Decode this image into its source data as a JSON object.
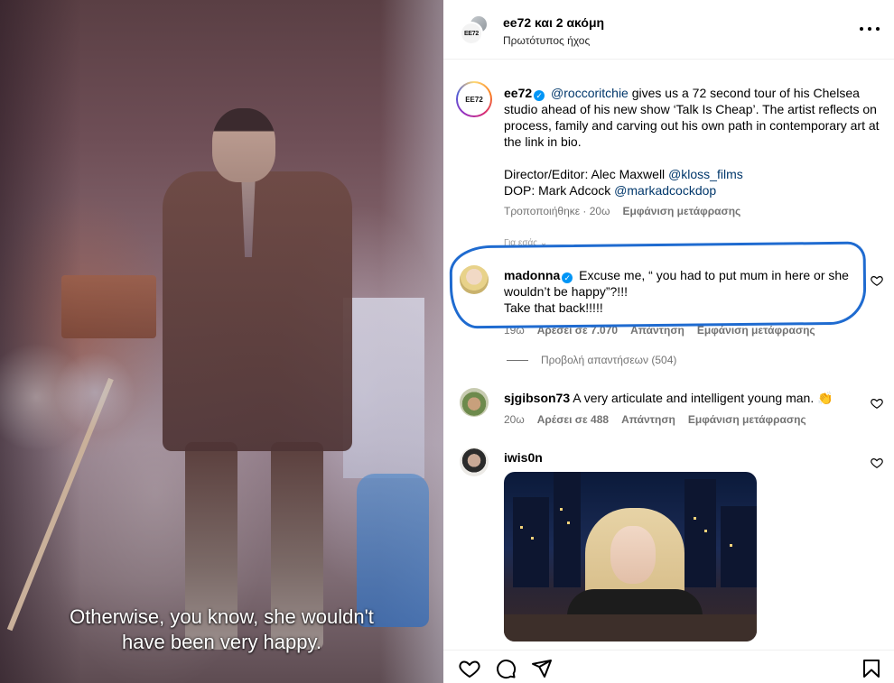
{
  "video": {
    "subtitle_line1": "Otherwise, you know, she wouldn't",
    "subtitle_line2": "have been very happy."
  },
  "header": {
    "username": "ee72",
    "and_more": "και 2 ακόμη",
    "audio": "Πρωτότυπος ήχος",
    "avatar_text": "EE72"
  },
  "caption": {
    "username": "ee72",
    "mention1": "@roccoritchie",
    "text1": "gives us a 72 second tour of his Chelsea studio ahead of his new show ‘Talk Is Cheap’. The artist reflects on process, family and carving out his own path in contemporary art at the link in bio.",
    "director_label": "Director/Editor: Alec Maxwell",
    "director_handle": "@kloss_films",
    "dop_label": "DOP: Mark Adcock",
    "dop_handle": "@markadcockdop",
    "edited": "Τροποποιήθηκε · 20ω",
    "see_translation": "Εμφάνιση μετάφρασης",
    "hidden_peek": "Για εσάς ⌄"
  },
  "comments": [
    {
      "username": "madonna",
      "verified": true,
      "text_l1": "Excuse me, “ you had to put mum in here or she",
      "text_l2": "wouldn’t be happy”?!!!",
      "text_l3": "Take that back!!!!!",
      "time": "19ω",
      "likes": "Αρέσει σε 7.070",
      "reply": "Απάντηση",
      "see_translation": "Εμφάνιση μετάφρασης",
      "view_replies": "Προβολή απαντήσεων (504)"
    },
    {
      "username": "sjgibson73",
      "text": "A very articulate and intelligent young man. 👏",
      "time": "20ω",
      "likes": "Αρέσει σε 488",
      "reply": "Απάντηση",
      "see_translation": "Εμφάνιση μετάφρασης"
    },
    {
      "username": "iwis0n",
      "media": "gif"
    }
  ],
  "icons": {
    "more": "more-icon",
    "heart": "heart-icon",
    "comment": "comment-icon",
    "share": "share-icon",
    "save": "bookmark-icon",
    "verified": "✓"
  },
  "colors": {
    "mention": "#00376b",
    "meta": "#737373",
    "verified": "#0095f6",
    "highlight_circle": "#1f6bd0"
  }
}
